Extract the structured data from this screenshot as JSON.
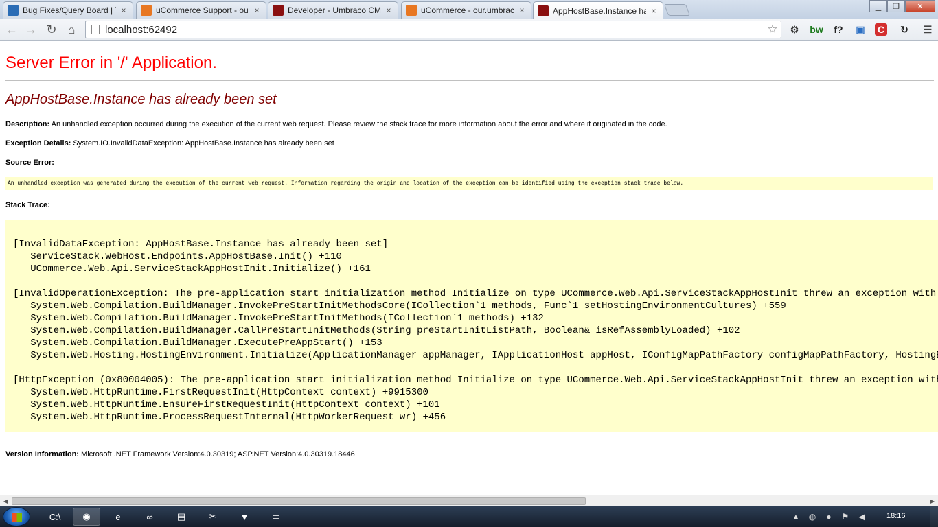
{
  "browser": {
    "tabs": [
      {
        "title": "Bug Fixes/Query Board | T",
        "favicon": "trello-icon",
        "color": "#2a6cb5"
      },
      {
        "title": "uCommerce Support - our.",
        "favicon": "umbraco-icon",
        "color": "#e87722"
      },
      {
        "title": "Developer - Umbraco CM",
        "favicon": "umbraco-cms-icon",
        "color": "#8a1010"
      },
      {
        "title": "uCommerce - our.umbrac",
        "favicon": "umbraco-icon",
        "color": "#e87722"
      },
      {
        "title": "AppHostBase.Instance has",
        "favicon": "umbraco-cms-icon",
        "color": "#8a1010"
      }
    ],
    "tab_close_glyph": "×",
    "window_buttons": {
      "minimize": "▁",
      "maximize": "❐",
      "close": "✕"
    },
    "url": "localhost:62492",
    "extensions": [
      {
        "name": "gear-icon",
        "glyph": "⚙",
        "color": "#333"
      },
      {
        "name": "bw-icon",
        "glyph": "bw",
        "color": "#1d7a1d"
      },
      {
        "name": "f-question-icon",
        "glyph": "f?",
        "color": "#222"
      },
      {
        "name": "screen-icon",
        "glyph": "▣",
        "color": "#2b6fc4"
      },
      {
        "name": "c-red-icon",
        "glyph": "C",
        "color": "#fff"
      },
      {
        "name": "sync-icon",
        "glyph": "↻",
        "color": "#222"
      },
      {
        "name": "wrench-menu-icon",
        "glyph": "☰",
        "color": "#444"
      }
    ]
  },
  "page": {
    "server_error": "Server Error in '/' Application.",
    "error_title": "AppHostBase.Instance has already been set",
    "description_label": "Description:",
    "description_text": "An unhandled exception occurred during the execution of the current web request. Please review the stack trace for more information about the error and where it originated in the code.",
    "exception_label": "Exception Details:",
    "exception_text": "System.IO.InvalidDataException: AppHostBase.Instance has already been set",
    "source_label": "Source Error:",
    "source_text": "An unhandled exception was generated during the execution of the current web request. Information regarding the origin and location of the exception can be identified using the exception stack trace below.",
    "stack_label": "Stack Trace:",
    "stack_lines": [
      "[InvalidDataException: AppHostBase.Instance has already been set]",
      "   ServiceStack.WebHost.Endpoints.AppHostBase.Init() +110",
      "   UCommerce.Web.Api.ServiceStackAppHostInit.Initialize() +161",
      "",
      "[InvalidOperationException: The pre-application start initialization method Initialize on type UCommerce.Web.Api.ServiceStackAppHostInit threw an exception with the fol",
      "   System.Web.Compilation.BuildManager.InvokePreStartInitMethodsCore(ICollection`1 methods, Func`1 setHostingEnvironmentCultures) +559",
      "   System.Web.Compilation.BuildManager.InvokePreStartInitMethods(ICollection`1 methods) +132",
      "   System.Web.Compilation.BuildManager.CallPreStartInitMethods(String preStartInitListPath, Boolean& isRefAssemblyLoaded) +102",
      "   System.Web.Compilation.BuildManager.ExecutePreAppStart() +153",
      "   System.Web.Hosting.HostingEnvironment.Initialize(ApplicationManager appManager, IApplicationHost appHost, IConfigMapPathFactory configMapPathFactory, HostingEnvironme",
      "",
      "[HttpException (0x80004005): The pre-application start initialization method Initialize on type UCommerce.Web.Api.ServiceStackAppHostInit threw an exception with the fol",
      "   System.Web.HttpRuntime.FirstRequestInit(HttpContext context) +9915300",
      "   System.Web.HttpRuntime.EnsureFirstRequestInit(HttpContext context) +101",
      "   System.Web.HttpRuntime.ProcessRequestInternal(HttpWorkerRequest wr) +456"
    ],
    "version_label": "Version Information:",
    "version_text": "Microsoft .NET Framework Version:4.0.30319; ASP.NET Version:4.0.30319.18446"
  },
  "taskbar": {
    "apps": [
      {
        "name": "taskbar-console-app",
        "glyph": "C:\\",
        "active": false
      },
      {
        "name": "taskbar-chrome-app",
        "glyph": "◉",
        "active": true
      },
      {
        "name": "taskbar-ie-app",
        "glyph": "e",
        "active": false
      },
      {
        "name": "taskbar-visual-studio-app",
        "glyph": "∞",
        "active": false
      },
      {
        "name": "taskbar-disk-app",
        "glyph": "▤",
        "active": false
      },
      {
        "name": "taskbar-tools-app",
        "glyph": "✂",
        "active": false
      },
      {
        "name": "taskbar-fox-app",
        "glyph": "▼",
        "active": false
      },
      {
        "name": "taskbar-explorer-app",
        "glyph": "▭",
        "active": false
      }
    ],
    "tray": [
      {
        "name": "tray-overflow-icon",
        "glyph": "▲"
      },
      {
        "name": "tray-network-icon",
        "glyph": "◍"
      },
      {
        "name": "tray-globe-icon",
        "glyph": "●"
      },
      {
        "name": "tray-flag-icon",
        "glyph": "⚑"
      },
      {
        "name": "tray-volume-icon",
        "glyph": "◀"
      }
    ],
    "clock": "18:16"
  }
}
